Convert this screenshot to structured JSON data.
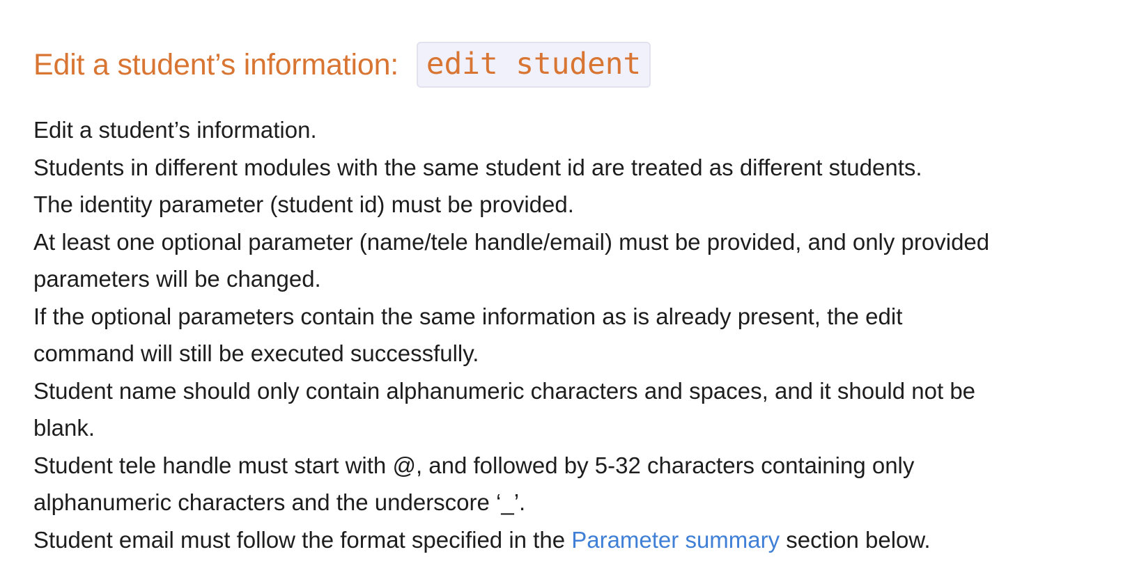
{
  "heading": {
    "text": "Edit a student’s information: ",
    "code": "edit student"
  },
  "paragraph": {
    "lines": [
      "Edit a student’s information.",
      "Students in different modules with the same student id are treated as different students.",
      "The identity parameter (student id) must be provided.",
      "At least one optional parameter (name/tele handle/email) must be provided, and only provided",
      "parameters will be changed.",
      "If the optional parameters contain the same information as is already present, the edit",
      "command will still be executed successfully.",
      "Student name should only contain alphanumeric characters and spaces, and it should not be",
      "blank.",
      "Student tele handle must start with @, and followed by 5-32 characters containing only",
      "alphanumeric characters and the underscore ‘_’."
    ],
    "last_line": {
      "before": "Student email must follow the format specified in the ",
      "link": "Parameter summary",
      "after": " section below."
    }
  },
  "colors": {
    "heading": "#d87533",
    "link": "#3f7fd6",
    "code_background": "#f1f1fb"
  }
}
